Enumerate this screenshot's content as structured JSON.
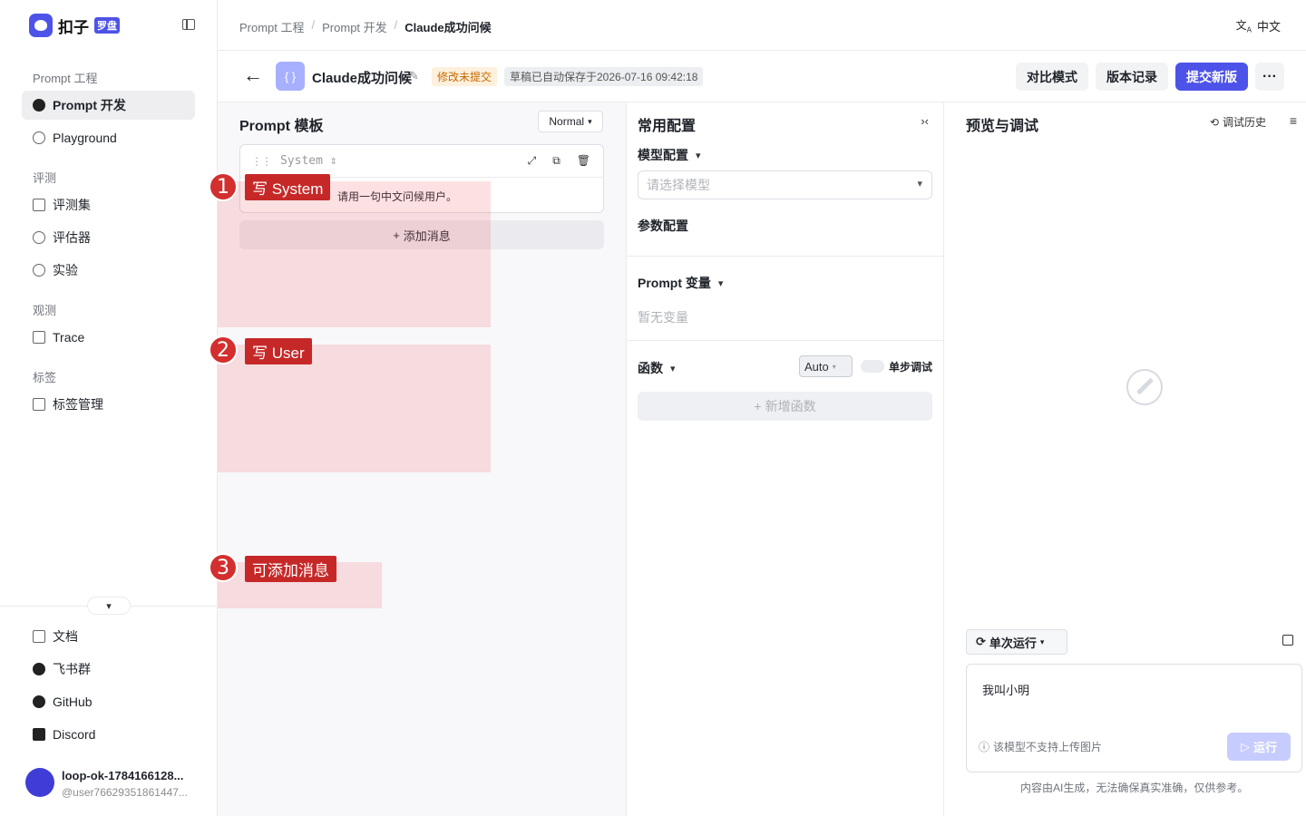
{
  "brand": {
    "name": "扣子",
    "tag": "罗盘"
  },
  "sidebar": {
    "sections": [
      {
        "title": "Prompt 工程",
        "items": [
          {
            "label": "Prompt 开发",
            "active": true
          },
          {
            "label": "Playground"
          }
        ]
      },
      {
        "title": "评测",
        "items": [
          {
            "label": "评测集"
          },
          {
            "label": "评估器"
          },
          {
            "label": "实验"
          }
        ]
      },
      {
        "title": "观测",
        "items": [
          {
            "label": "Trace"
          }
        ]
      },
      {
        "title": "标签",
        "items": [
          {
            "label": "标签管理"
          }
        ]
      }
    ],
    "footer": [
      {
        "label": "文档"
      },
      {
        "label": "飞书群"
      },
      {
        "label": "GitHub"
      },
      {
        "label": "Discord"
      }
    ],
    "user": {
      "name": "loop-ok-1784166128...",
      "handle": "@user76629351861447..."
    }
  },
  "topbar": {
    "breadcrumb": [
      "Prompt 工程",
      "Prompt 开发",
      "Claude成功问候"
    ],
    "separator": "/",
    "lang": "中文"
  },
  "header": {
    "title": "Claude成功问候",
    "status_badge": "修改未提交",
    "save_badge": "草稿已自动保存于2026-07-16 09:42:18",
    "buttons": {
      "compare": "对比模式",
      "history": "版本记录",
      "submit": "提交新版",
      "more": "···"
    }
  },
  "template": {
    "title": "Prompt 模板",
    "mode": "Normal",
    "message": {
      "role": "System",
      "content_visible": "请用一句中文问候用户。"
    },
    "add_message": "添加消息"
  },
  "annotations": [
    {
      "num": "1",
      "text": "写 System"
    },
    {
      "num": "2",
      "text": "写 User"
    },
    {
      "num": "3",
      "text": "可添加消息"
    }
  ],
  "config": {
    "title": "常用配置",
    "model_label": "模型配置",
    "model_placeholder": "请选择模型",
    "param_label": "参数配置",
    "vars_label": "Prompt 变量",
    "vars_empty": "暂无变量",
    "func_label": "函数",
    "func_mode": "Auto",
    "step_debug": "单步调试",
    "add_func": "新增函数"
  },
  "preview": {
    "title": "预览与调试",
    "history": "调试历史",
    "run_mode": "单次运行",
    "input_value": "我叫小明",
    "img_note": "该模型不支持上传图片",
    "run_button": "运行",
    "disclaimer": "内容由AI生成，无法确保真实准确，仅供参考。"
  }
}
